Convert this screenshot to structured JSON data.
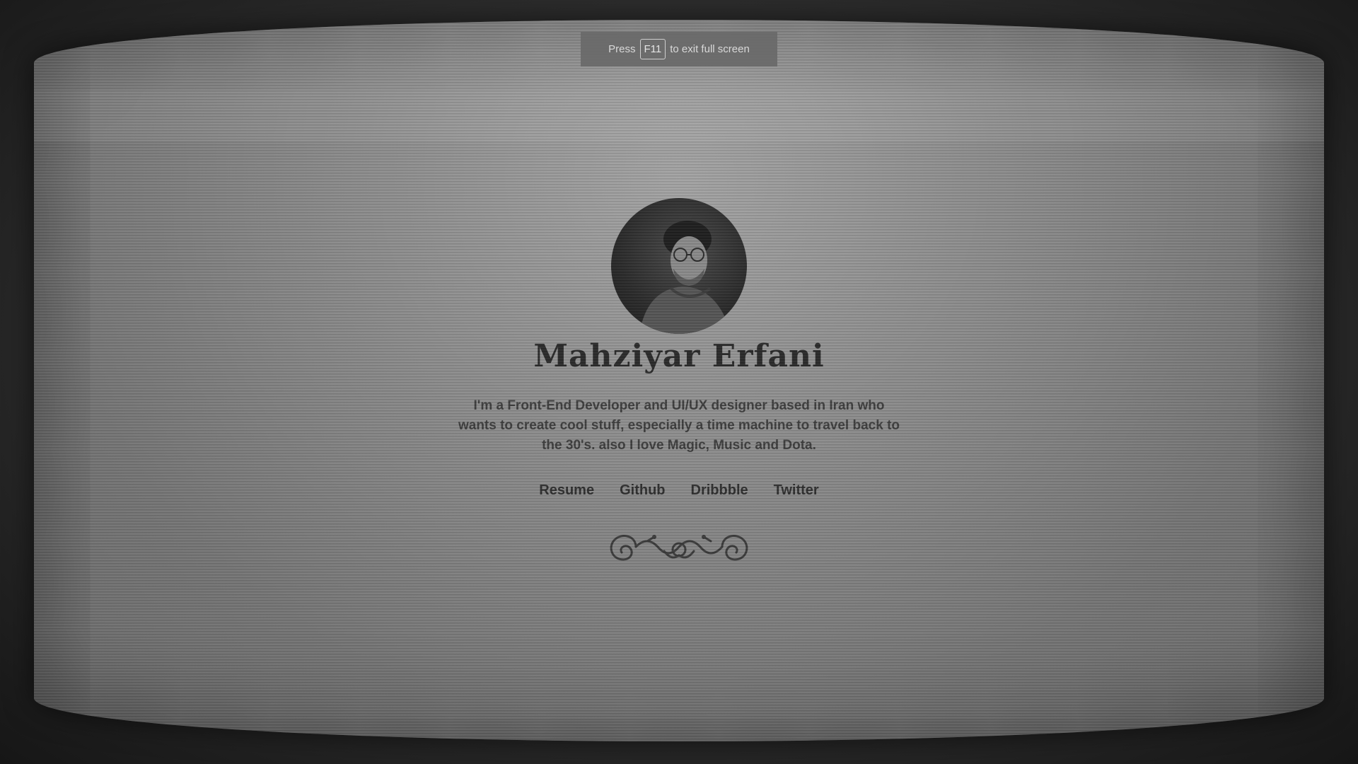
{
  "fullscreen_notice": {
    "prefix": "Press",
    "key": "F11",
    "suffix": "to exit full screen"
  },
  "profile": {
    "name": "Mahziyar Erfani",
    "bio": "I'm a Front-End Developer and UI/UX designer based in Iran who wants to create cool stuff, especially a time machine to travel back to the 30's. also I love Magic, Music and Dota."
  },
  "links": [
    {
      "label": "Resume"
    },
    {
      "label": "Github"
    },
    {
      "label": "Dribbble"
    },
    {
      "label": "Twitter"
    }
  ],
  "colors": {
    "screen": "#8c8c8c",
    "text_dark": "#2a2a2a",
    "banner": "#696969"
  },
  "icons": {
    "ornament": "flourish-ornament-icon",
    "avatar": "profile-photo"
  }
}
